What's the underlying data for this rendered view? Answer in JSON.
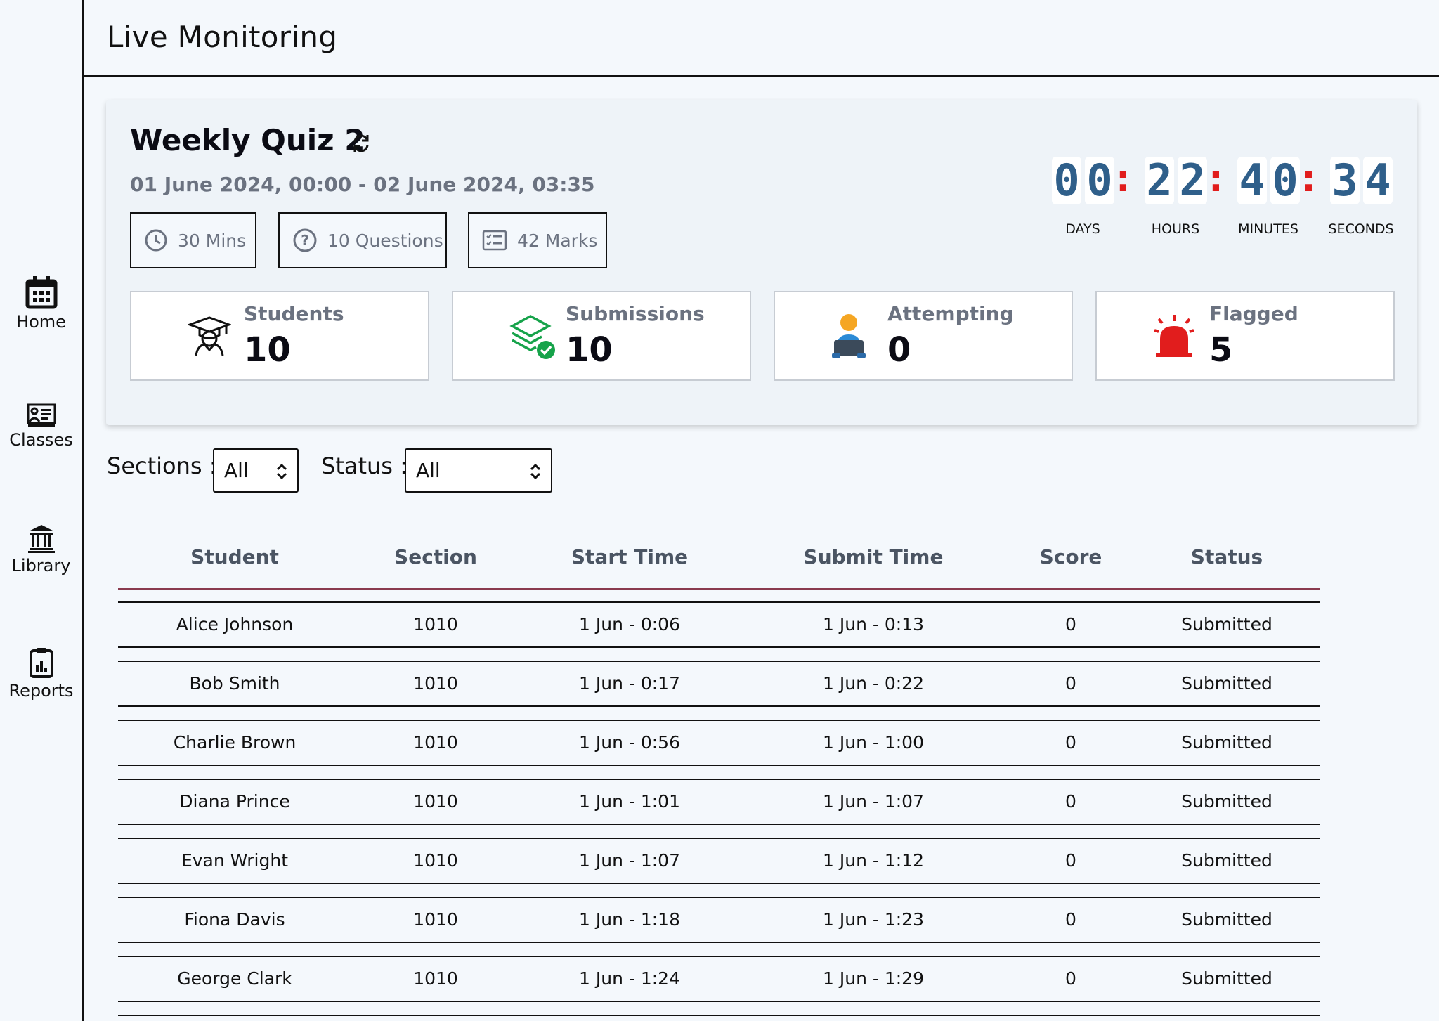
{
  "header": {
    "title": "Live Monitoring"
  },
  "sidebar": {
    "items": [
      {
        "label": "Home",
        "icon": "calendar-icon"
      },
      {
        "label": "Classes",
        "icon": "classes-icon"
      },
      {
        "label": "Library",
        "icon": "library-icon"
      },
      {
        "label": "Reports",
        "icon": "clipboard-report-icon"
      }
    ]
  },
  "quiz": {
    "title": "Weekly Quiz 2",
    "dates": "01 June 2024, 00:00 - 02 June 2024, 03:35",
    "meta": [
      {
        "label": "30 Mins",
        "icon": "clock-icon"
      },
      {
        "label": "10 Questions",
        "icon": "question-icon"
      },
      {
        "label": "42 Marks",
        "icon": "checklist-icon"
      }
    ]
  },
  "countdown": {
    "days": [
      "0",
      "0"
    ],
    "hours": [
      "2",
      "2"
    ],
    "minutes": [
      "4",
      "0"
    ],
    "seconds": [
      "3",
      "4"
    ],
    "labels": {
      "days": "DAYS",
      "hours": "HOURS",
      "minutes": "MINUTES",
      "seconds": "SECONDS"
    }
  },
  "stats": [
    {
      "label": "Students",
      "value": "10",
      "icon": "graduation-cap-icon",
      "color": "#111111"
    },
    {
      "label": "Submissions",
      "value": "10",
      "icon": "stack-check-icon",
      "color": "#16a34a"
    },
    {
      "label": "Attempting",
      "value": "0",
      "icon": "person-laptop-icon",
      "color": "#f5a623"
    },
    {
      "label": "Flagged",
      "value": "5",
      "icon": "alarm-siren-icon",
      "color": "#e11d1d"
    }
  ],
  "filters": {
    "sections_label": "Sections :",
    "sections_value": "All",
    "status_label": "Status :",
    "status_value": "All"
  },
  "table": {
    "columns": [
      "Student",
      "Section",
      "Start Time",
      "Submit Time",
      "Score",
      "Status"
    ],
    "rows": [
      [
        "Alice Johnson",
        "1010",
        "1 Jun - 0:06",
        "1 Jun - 0:13",
        "0",
        "Submitted"
      ],
      [
        "Bob Smith",
        "1010",
        "1 Jun - 0:17",
        "1 Jun - 0:22",
        "0",
        "Submitted"
      ],
      [
        "Charlie Brown",
        "1010",
        "1 Jun - 0:56",
        "1 Jun - 1:00",
        "0",
        "Submitted"
      ],
      [
        "Diana Prince",
        "1010",
        "1 Jun - 1:01",
        "1 Jun - 1:07",
        "0",
        "Submitted"
      ],
      [
        "Evan Wright",
        "1010",
        "1 Jun - 1:07",
        "1 Jun - 1:12",
        "0",
        "Submitted"
      ],
      [
        "Fiona Davis",
        "1010",
        "1 Jun - 1:18",
        "1 Jun - 1:23",
        "0",
        "Submitted"
      ],
      [
        "George Clark",
        "1010",
        "1 Jun - 1:24",
        "1 Jun - 1:29",
        "0",
        "Submitted"
      ]
    ]
  }
}
